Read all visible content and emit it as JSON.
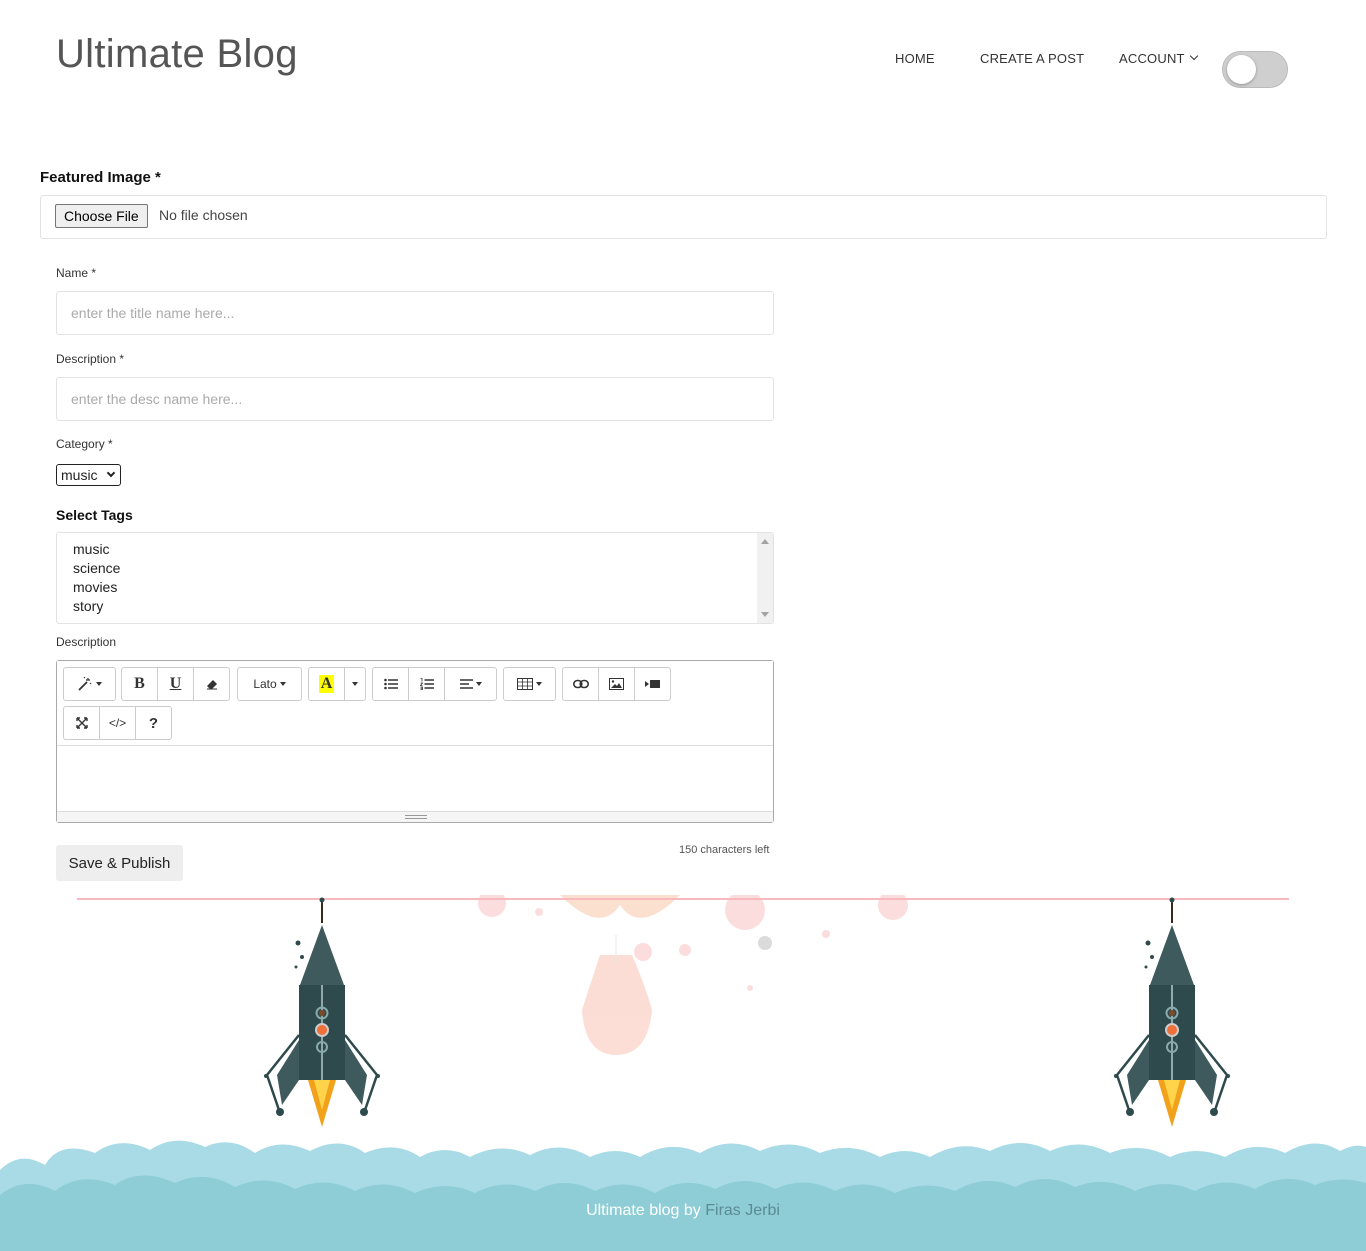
{
  "header": {
    "site_title": "Ultimate Blog",
    "nav": {
      "home": "HOME",
      "create_post": "CREATE A POST",
      "account": "ACCOUNT"
    }
  },
  "form": {
    "featured_image": {
      "label": "Featured Image *",
      "button": "Choose File",
      "status": "No file chosen"
    },
    "name": {
      "label": "Name *",
      "placeholder": "enter the title name here...",
      "value": ""
    },
    "description": {
      "label": "Description *",
      "placeholder": "enter the desc name here...",
      "value": ""
    },
    "category": {
      "label": "Category *",
      "selected": "music"
    },
    "tags": {
      "label": "Select Tags",
      "options": [
        "music",
        "science",
        "movies",
        "story"
      ]
    },
    "editor": {
      "label": "Description",
      "font_name": "Lato",
      "bold_glyph": "B",
      "underline_glyph": "U",
      "color_glyph": "A",
      "codeview_glyph": "</>",
      "help_glyph": "?",
      "content": ""
    },
    "chars_left": "150 characters left",
    "submit": "Save & Publish"
  },
  "icons": {
    "magic": "magic-wand-icon",
    "eraser": "eraser-icon",
    "ul": "unordered-list-icon",
    "ol": "ordered-list-icon",
    "align": "align-icon",
    "table": "table-icon",
    "link": "link-icon",
    "picture": "picture-icon",
    "video": "video-icon",
    "fullscreen": "fullscreen-icon"
  },
  "footer": {
    "credit_prefix": "Ultimate blog by ",
    "author": "Firas Jerbi"
  },
  "colors": {
    "cloud_light": "#a8dbe6",
    "cloud_dark": "#8ecdd6",
    "rocket_body": "#2f4a4c",
    "flame": "#f5b21f",
    "author_link": "#5c8b94",
    "line_accent": "#f7b9bd"
  }
}
